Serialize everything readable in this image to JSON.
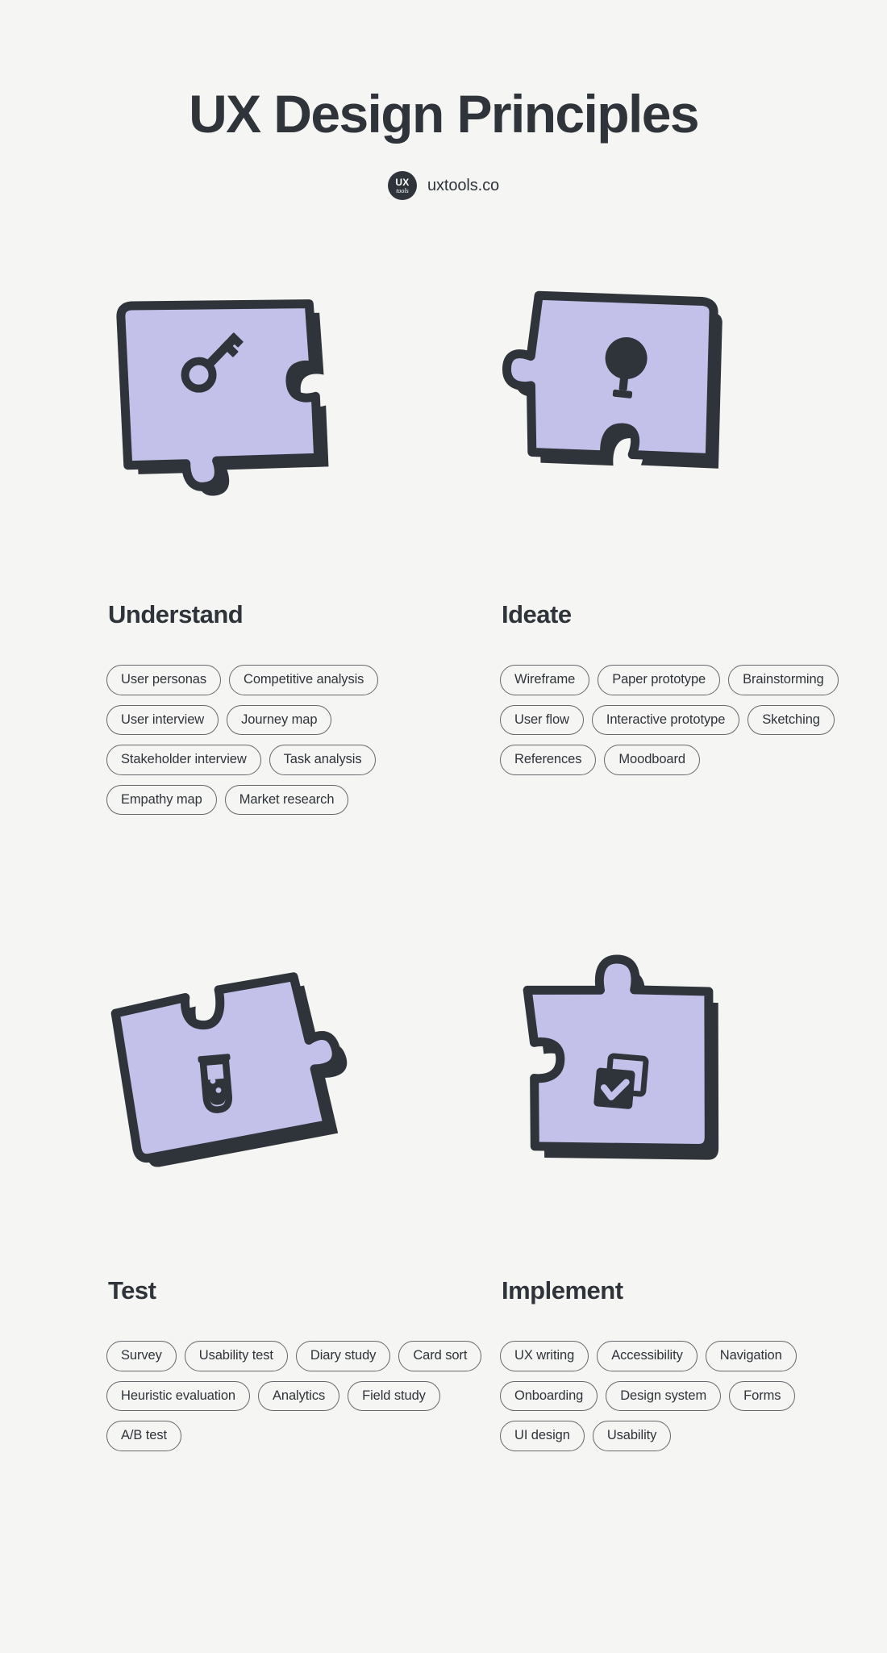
{
  "header": {
    "title": "UX Design Principles",
    "brand": {
      "logo_line1": "UX",
      "logo_line2": "tools",
      "name": "uxtools.co"
    }
  },
  "colors": {
    "background": "#f5f5f3",
    "ink": "#2f343a",
    "puzzle_fill": "#c3c1ea",
    "puzzle_outline": "#2f343a",
    "tag_border": "#66686c"
  },
  "sections": [
    {
      "title": "Understand",
      "icon": "key-icon",
      "tags": [
        "User personas",
        "Competitive analysis",
        "User interview",
        "Journey map",
        "Stakeholder interview",
        "Task analysis",
        "Empathy map",
        "Market research"
      ]
    },
    {
      "title": "Ideate",
      "icon": "lightbulb-icon",
      "tags": [
        "Wireframe",
        "Paper prototype",
        "Brainstorming",
        "User flow",
        "Interactive prototype",
        "Sketching",
        "References",
        "Moodboard"
      ]
    },
    {
      "title": "Test",
      "icon": "test-tube-icon",
      "tags": [
        "Survey",
        "Usability test",
        "Diary study",
        "Card sort",
        "Heuristic evaluation",
        "Analytics",
        "Field study",
        "A/B test"
      ]
    },
    {
      "title": "Implement",
      "icon": "checkbox-tasks-icon",
      "tags": [
        "UX writing",
        "Accessibility",
        "Navigation",
        "Onboarding",
        "Design system",
        "Forms",
        "UI design",
        "Usability"
      ]
    }
  ]
}
